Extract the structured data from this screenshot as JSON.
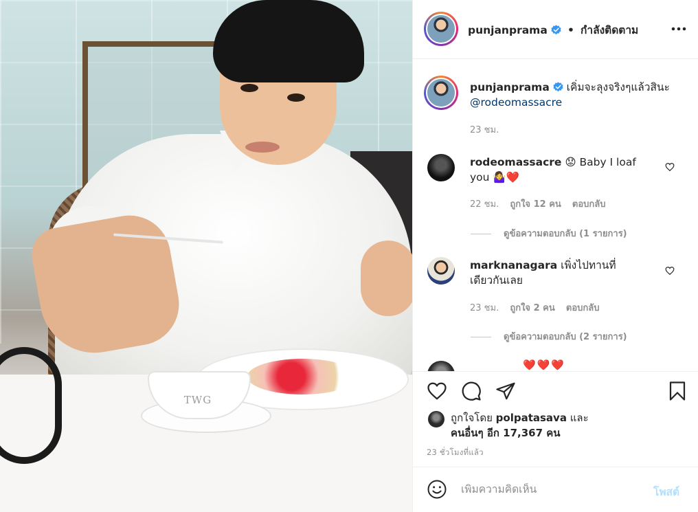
{
  "header": {
    "username": "punjanprama",
    "separator": "•",
    "follow_label": "กำลังติดตาม",
    "more_icon": "more-dots-icon"
  },
  "caption": {
    "username": "punjanprama",
    "text": "เคิ่มจะลุงจริงๆแล้วสินะ",
    "mention": "@rodeomassacre",
    "time": "23 ชม."
  },
  "comments": [
    {
      "username": "rodeomassacre",
      "text_line1": "Baby I loaf",
      "text_line2": "you",
      "emojis": [
        "😟",
        "🤷‍♀️",
        "❤️"
      ],
      "time": "22 ชม.",
      "likes": "ถูกใจ 12 คน",
      "reply_label": "ตอบกลับ",
      "view_replies": "ดูข้อความตอบกลับ (1 รายการ)"
    },
    {
      "username": "marknanagara",
      "text_line1": "เพิ่งไปทานที่",
      "text_line2": "เดียวกันเลย",
      "time": "23 ชม.",
      "likes": "ถูกใจ 2 คน",
      "reply_label": "ตอบกลับ",
      "view_replies": "ดูข้อความตอบกลับ (2 รายการ)"
    }
  ],
  "partial_comment_emojis": "❤️❤️❤️",
  "actions": {
    "like_icon": "heart-icon",
    "comment_icon": "comment-bubble-icon",
    "share_icon": "paper-plane-icon",
    "save_icon": "bookmark-icon"
  },
  "likes": {
    "prefix": "ถูกใจโดย",
    "first_user": "polpatasava",
    "joiner": "และ",
    "others": "คนอื่นๆ อีก 17,367 คน"
  },
  "post_time": "23 ชั่วโมงที่แล้ว",
  "add_comment": {
    "placeholder": "เพิ่มความคิดเห็น",
    "post_label": "โพสต์",
    "emoji_icon": "smiley-icon"
  },
  "photo": {
    "cup_logo": "TWG"
  },
  "colors": {
    "verified_blue": "#3897f0",
    "text": "#262626",
    "muted": "#8e8e8e",
    "post_button_disabled": "#b2dffc",
    "emoji_heart": "#ed2a3c"
  }
}
